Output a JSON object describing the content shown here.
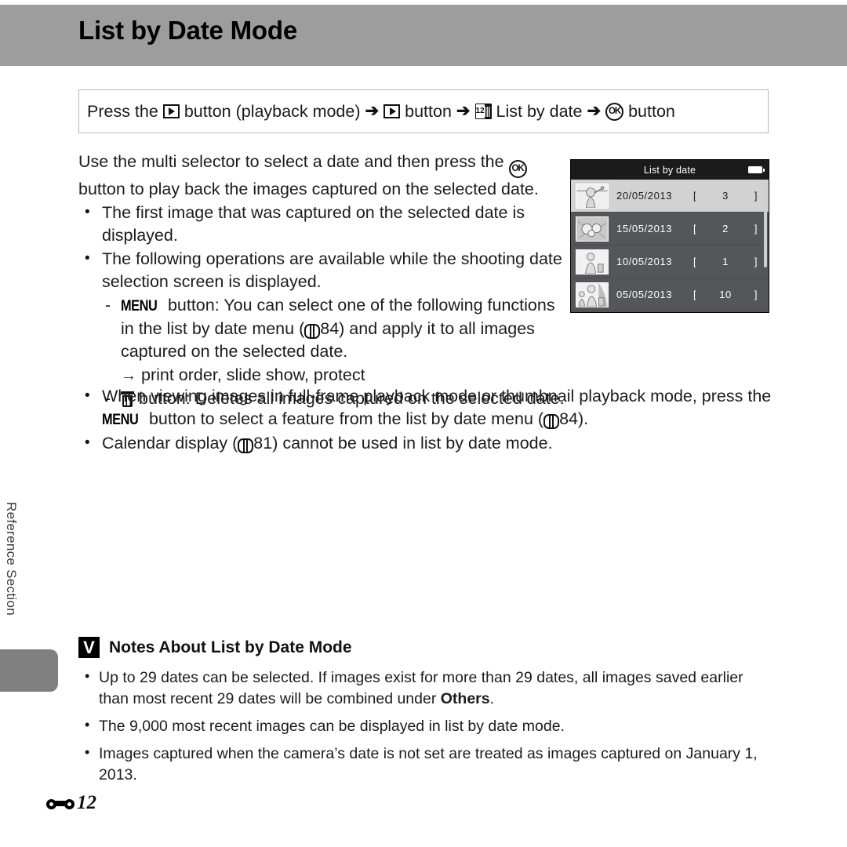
{
  "header": {
    "title": "List by Date Mode"
  },
  "side": {
    "vertical_label": "Reference Section"
  },
  "instruction": {
    "press_the": "Press the",
    "playback_icon": "playback-button-icon",
    "button_word_1": "button (playback mode)",
    "arrow_1": "➔",
    "playback_icon_2": "playback-button-icon",
    "button_word_2": "button",
    "arrow_2": "➔",
    "calendar_icon": "list-by-date-icon",
    "calendar_number": "12",
    "list_by_date": "List by date",
    "arrow_3": "➔",
    "ok_icon_label": "OK",
    "button_word_3": "button"
  },
  "body": {
    "intro_line_1": "Use the multi selector to select a date and then press the",
    "intro_line_2": "button to play back the images captured on the selected date.",
    "bullet_1": "The first image that was captured on the selected date is displayed.",
    "bullet_2": "The following operations are available while the shooting date selection screen is displayed.",
    "sub_menu_prefix": "MENU",
    "sub_menu_text_a": "button: You can select one of the following functions in the list by date menu (",
    "sub_menu_page": "84",
    "sub_menu_text_b": ") and apply it to all images captured on the selected date.",
    "sub_arrow_text": "print order, slide show, protect",
    "sub_trash_text": "button: Deletes all images captured on the selected date.",
    "bullet_3_a": "When viewing images in full-frame playback mode or thumbnail playback mode, press the",
    "bullet_3_b": "button to select a feature from the list by date menu (",
    "bullet_3_page": "84",
    "bullet_3_c": ").",
    "bullet_4_a": "Calendar display (",
    "bullet_4_page": "81",
    "bullet_4_b": ") cannot be used in list by date mode."
  },
  "camera_screen": {
    "title": "List by date",
    "battery_icon": "battery-icon",
    "rows": [
      {
        "date": "20/05/2013",
        "bracket_open": "[",
        "count": "3",
        "bracket_close": "]",
        "selected": true,
        "thumb": "person-waving-thumbnail"
      },
      {
        "date": "15/05/2013",
        "bracket_open": "[",
        "count": "2",
        "bracket_close": "]",
        "selected": false,
        "thumb": "flowers-thumbnail"
      },
      {
        "date": "10/05/2013",
        "bracket_open": "[",
        "count": "1",
        "bracket_close": "]",
        "selected": false,
        "thumb": "woman-child-thumbnail"
      },
      {
        "date": "05/05/2013",
        "bracket_open": "[",
        "count": "10",
        "bracket_close": "]",
        "selected": false,
        "thumb": "family-thumbnail"
      }
    ]
  },
  "notes": {
    "icon": "caution-note-icon",
    "icon_glyph": "V",
    "title": "Notes About List by Date Mode",
    "items": [
      {
        "text_a": "Up to 29 dates can be selected. If images exist for more than 29 dates, all images saved earlier than most recent 29 dates will be combined under ",
        "bold": "Others",
        "text_b": "."
      },
      {
        "text_a": "The 9,000 most recent images can be displayed in list by date mode.",
        "bold": "",
        "text_b": ""
      },
      {
        "text_a": "Images captured when the camera’s date is not set are treated as images captured on January 1, 2013.",
        "bold": "",
        "text_b": ""
      }
    ]
  },
  "footer": {
    "icon": "reference-section-icon",
    "page": "12"
  }
}
